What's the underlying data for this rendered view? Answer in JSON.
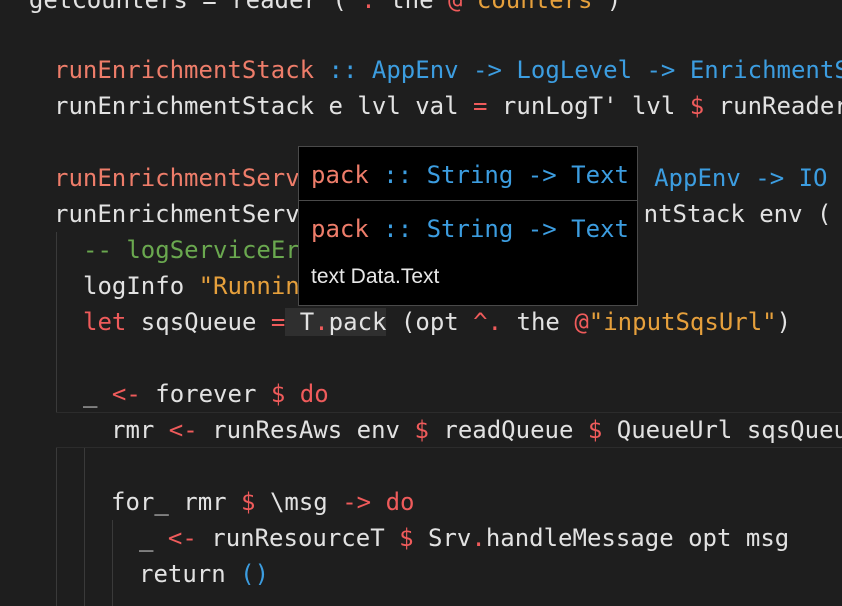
{
  "code": {
    "line0": {
      "a": "getCounters",
      "b": " = reader (",
      "c": "^.",
      "d": " the ",
      "e": "@",
      "f": "\"counters\"",
      "g": ")"
    },
    "line1": {
      "fn": "runEnrichmentStack",
      "sep": " ::",
      "t1": " AppEnv",
      "arr1": " ->",
      "t2": " LogLevel",
      "arr2": " ->",
      "t3": " EnrichmentS"
    },
    "line2": {
      "a": "runEnrichmentStack e lvl val",
      "eq": " =",
      "b": " runLogT' lvl",
      "dollar": " $",
      "c": " runReader"
    },
    "line3": {
      "fn": "runEnrichmentServ",
      "t1": " AppEnv",
      "arr": " ->",
      "t2": " IO"
    },
    "line4": {
      "a": "runEnrichmentServ",
      "b": "ntStack env ("
    },
    "line5": {
      "cm": "-- logServiceEr"
    },
    "line6": {
      "a": "logInfo ",
      "str": "\"Runnin"
    },
    "line7": {
      "kw": "let",
      "a": " sqsQueue",
      "eq": " =",
      "b": " T",
      "dot": ".",
      "c": "pack",
      "d": " (opt",
      "op": " ^.",
      "e": " the",
      "at": " @",
      "str": "\"inputSqsUrl\"",
      "f": ")"
    },
    "line9": {
      "a": "_",
      "arr": " <-",
      "b": " forever",
      "dollar": " $",
      "kw": " do"
    },
    "line10": {
      "a": "rmr",
      "arr": " <-",
      "b": " runResAws env",
      "d1": " $",
      "c": " readQueue",
      "d2": " $",
      "e": " QueueUrl sqsQueu"
    },
    "line12": {
      "a": "for_ rmr",
      "dollar": " $",
      "lam": " \\",
      "b": "msg",
      "arr": " ->",
      "kw": " do"
    },
    "line13": {
      "a": "_",
      "arr": " <-",
      "b": " runResourceT",
      "dollar": " $",
      "c": " Srv",
      "dot": ".",
      "d": "handleMessage opt msg"
    },
    "line14": {
      "a": "return",
      "b": " ()"
    }
  },
  "hover": {
    "sig1": {
      "name": "pack",
      "sep": " ::",
      "t1": " String",
      "arr": " ->",
      "t2": " Text"
    },
    "sig2": {
      "name": "pack",
      "sep": " ::",
      "t1": " String",
      "arr": " ->",
      "t2": " Text"
    },
    "doc": "text Data.Text"
  },
  "colors": {
    "background": "#1e1e1e",
    "function": "#ee7d6a",
    "keyword": "#ef5b5b",
    "type": "#3c9de0",
    "string": "#e6a03c",
    "comment": "#6aa84f"
  }
}
